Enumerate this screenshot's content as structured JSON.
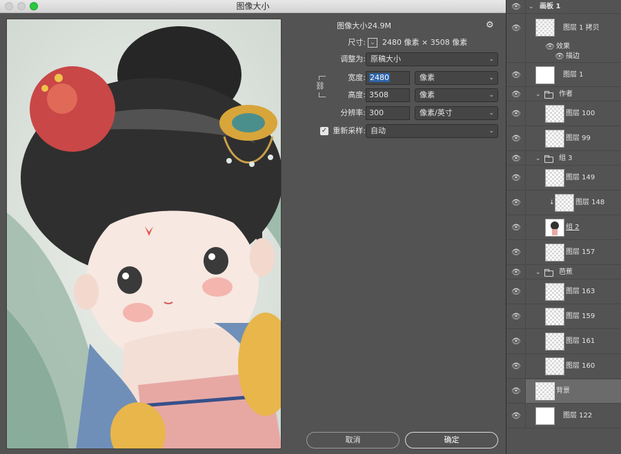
{
  "dialog": {
    "title": "图像大小",
    "image_size_label": "图像大小:",
    "image_size_value": "24.9M",
    "dimensions_label": "尺寸:",
    "dimensions_value": "2480 像素 × 3508 像素",
    "fit_to_label": "调整为:",
    "fit_to_value": "原稿大小",
    "width_label": "宽度:",
    "width_value": "2480",
    "width_unit": "像素",
    "height_label": "高度:",
    "height_value": "3508",
    "height_unit": "像素",
    "resolution_label": "分辨率:",
    "resolution_value": "300",
    "resolution_unit": "像素/英寸",
    "resample_label": "重新采样:",
    "resample_value": "自动",
    "cancel_label": "取消",
    "ok_label": "确定"
  },
  "layers": [
    {
      "name": "画板 1",
      "kind": "artboard"
    },
    {
      "name": "图层 1 拷贝",
      "kind": "layer"
    },
    {
      "name": "效果",
      "kind": "effect"
    },
    {
      "name": "描边",
      "kind": "effect"
    },
    {
      "name": "图层 1",
      "kind": "layer"
    },
    {
      "name": "作者",
      "kind": "group"
    },
    {
      "name": "图层 100",
      "kind": "layer"
    },
    {
      "name": "图层 99",
      "kind": "layer"
    },
    {
      "name": "组 3",
      "kind": "group"
    },
    {
      "name": "图层 149",
      "kind": "layer"
    },
    {
      "name": "图层 148",
      "kind": "layer"
    },
    {
      "name": "组 2",
      "kind": "layer"
    },
    {
      "name": "图层 157",
      "kind": "layer"
    },
    {
      "name": "芭蕉",
      "kind": "group"
    },
    {
      "name": "图层 163",
      "kind": "layer"
    },
    {
      "name": "图层 159",
      "kind": "layer"
    },
    {
      "name": "图层 161",
      "kind": "layer"
    },
    {
      "name": "图层 160",
      "kind": "layer"
    },
    {
      "name": "背景",
      "kind": "layer"
    },
    {
      "name": "图层 122",
      "kind": "layer"
    }
  ],
  "icons": {
    "eye": "eye-icon",
    "gear": "gear-icon",
    "chain": "chain-link-icon",
    "folder": "folder-icon"
  },
  "colors": {
    "panel_bg": "#535353",
    "selection": "#2d63a8",
    "traffic_green": "#28c840"
  }
}
